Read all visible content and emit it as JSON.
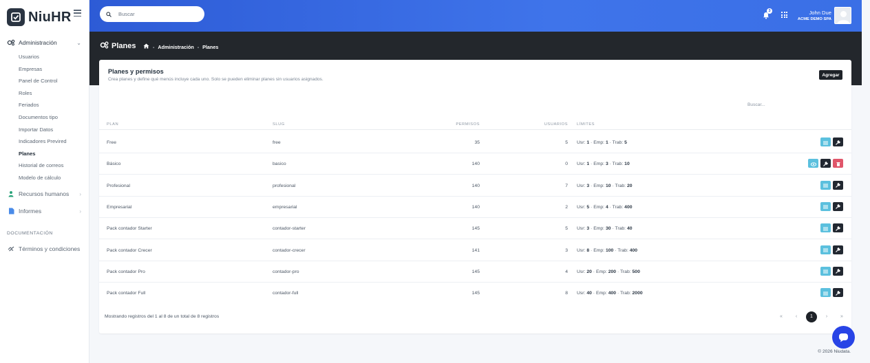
{
  "app": {
    "name": "NiuHR"
  },
  "topbar": {
    "search_placeholder": "Buscar",
    "notifications_count": "3",
    "user_name": "John Due",
    "user_company": "ACME DEMO SPA"
  },
  "sidebar": {
    "admin_label": "Administración",
    "admin_items": [
      "Usuarios",
      "Empresas",
      "Panel de Control",
      "Roles",
      "Feriados",
      "Documentos tipo",
      "Importar Datos",
      "Indicadores Previred",
      "Planes",
      "Historial de correos",
      "Modelo de cálculo"
    ],
    "active_item": "Planes",
    "hr_label": "Recursos humanos",
    "reports_label": "Informes",
    "docs_section": "DOCUMENTACIÓN",
    "terms_label": "Términos y condiciones"
  },
  "header": {
    "title": "Planes",
    "breadcrumb": [
      "Administración",
      "Planes"
    ]
  },
  "card": {
    "title": "Planes y permisos",
    "subtitle": "Crea planes y define qué menús incluye cada uno. Solo se pueden eliminar planes sin usuarios asignados.",
    "add_label": "Agregar",
    "search_placeholder": "Buscar..."
  },
  "table": {
    "columns": [
      "PLAN",
      "SLUG",
      "PERMISOS",
      "USUARIOS",
      "LÍMITES"
    ],
    "rows": [
      {
        "plan": "Free",
        "slug": "free",
        "permisos": "35",
        "usuarios": "5",
        "usr": "1",
        "emp": "1",
        "trab": "5"
      },
      {
        "plan": "Básico",
        "slug": "basico",
        "permisos": "140",
        "usuarios": "0",
        "usr": "1",
        "emp": "3",
        "trab": "10"
      },
      {
        "plan": "Profesional",
        "slug": "profesional",
        "permisos": "140",
        "usuarios": "7",
        "usr": "3",
        "emp": "10",
        "trab": "20"
      },
      {
        "plan": "Empresarial",
        "slug": "empresarial",
        "permisos": "140",
        "usuarios": "2",
        "usr": "5",
        "emp": "4",
        "trab": "400"
      },
      {
        "plan": "Pack contador Starter",
        "slug": "contador-starter",
        "permisos": "145",
        "usuarios": "5",
        "usr": "3",
        "emp": "30",
        "trab": "40"
      },
      {
        "plan": "Pack contador Crecer",
        "slug": "contador-crecer",
        "permisos": "141",
        "usuarios": "3",
        "usr": "8",
        "emp": "100",
        "trab": "400"
      },
      {
        "plan": "Pack contador Pro",
        "slug": "contador-pro",
        "permisos": "145",
        "usuarios": "4",
        "usr": "20",
        "emp": "200",
        "trab": "500"
      },
      {
        "plan": "Pack contador Full",
        "slug": "contador-full",
        "permisos": "145",
        "usuarios": "8",
        "usr": "40",
        "emp": "400",
        "trab": "2000"
      }
    ],
    "limit_labels": {
      "usr": "Usr:",
      "emp": "Emp:",
      "trab": "Trab:"
    }
  },
  "footer": {
    "summary": "Mostrando registros del 1 al 8 de un total de 8 registros",
    "current_page": "1",
    "pager": {
      "first": "«",
      "prev": "‹",
      "next": "›",
      "last": "»"
    },
    "copyright": "© 2026 Niudata."
  },
  "colors": {
    "topbar": "#3a6fe6",
    "dark_band": "#23272c",
    "info_button": "#5bc0de",
    "danger_button": "#e0566a",
    "fab": "#2844e6"
  }
}
